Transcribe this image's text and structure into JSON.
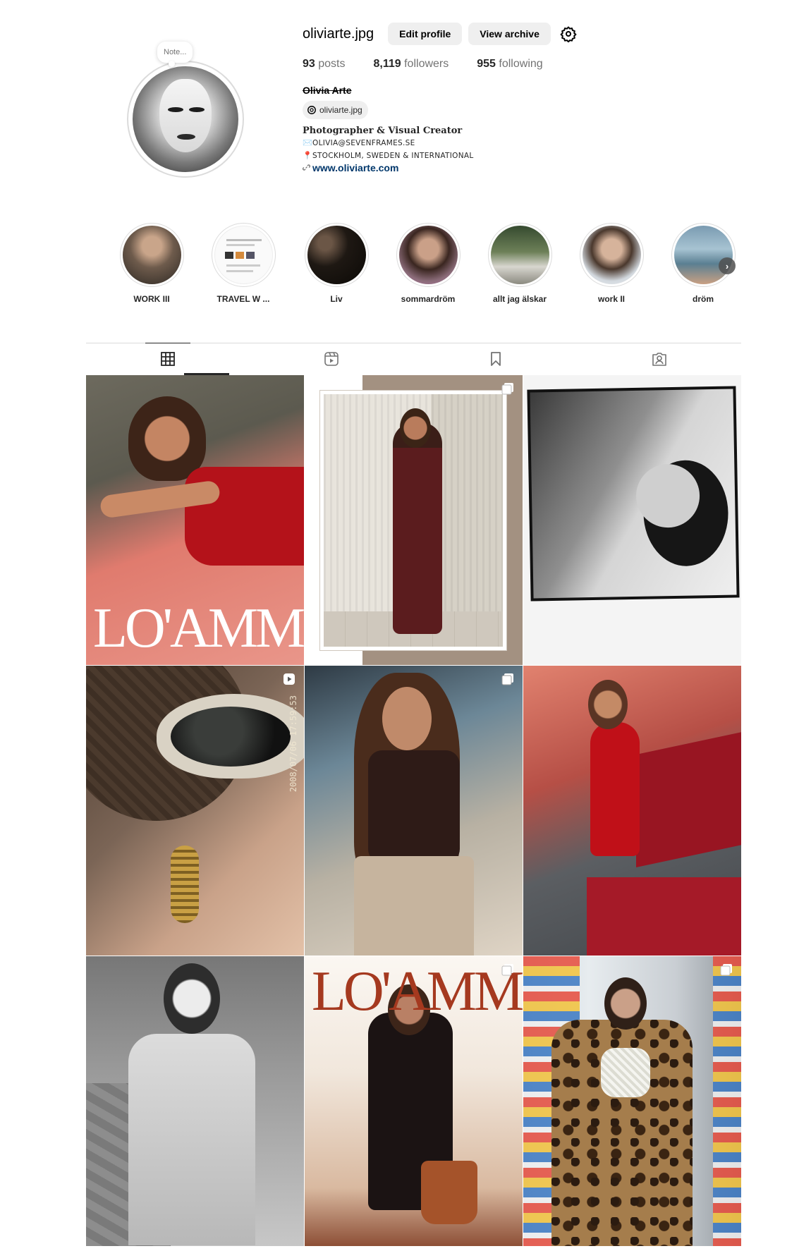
{
  "profile": {
    "username": "oliviarte.jpg",
    "edit_profile_label": "Edit profile",
    "view_archive_label": "View archive",
    "note_placeholder": "Note...",
    "stats": {
      "posts_count": "93",
      "posts_label": "posts",
      "followers_count": "8,119",
      "followers_label": "followers",
      "following_count": "955",
      "following_label": "following"
    },
    "full_name": "Olivia Arte",
    "threads_handle": "oliviarte.jpg",
    "bio": {
      "title": "Photographer & Visual Creator",
      "email_icon": "✉️",
      "email": "OLIVIA@SEVENFRAMES.SE",
      "location_icon": "📍",
      "location": "STOCKHOLM, SWEDEN & INTERNATIONAL",
      "link": "www.oliviarte.com"
    }
  },
  "highlights": [
    {
      "label": "WORK III"
    },
    {
      "label": "TRAVEL W ..."
    },
    {
      "label": "Liv"
    },
    {
      "label": "sommardröm"
    },
    {
      "label": "allt jag älskar"
    },
    {
      "label": "work II"
    },
    {
      "label": "dröm"
    }
  ],
  "tabs": [
    {
      "name": "posts",
      "icon": "grid-icon",
      "active": true
    },
    {
      "name": "reels",
      "icon": "reels-icon",
      "active": false
    },
    {
      "name": "saved",
      "icon": "bookmark-icon",
      "active": false
    },
    {
      "name": "tagged",
      "icon": "tagged-icon",
      "active": false
    }
  ],
  "posts": [
    {
      "wordmark": "LO'AMMI",
      "badge": "none"
    },
    {
      "badge": "carousel-icon"
    },
    {
      "badge": "none"
    },
    {
      "badge": "reel-icon",
      "stamp": "2008/07/06  17:59:53"
    },
    {
      "badge": "carousel-icon"
    },
    {
      "badge": "none"
    },
    {
      "badge": "none"
    },
    {
      "wordmark": "LO'AMMI",
      "badge": "carousel-icon"
    },
    {
      "badge": "carousel-icon"
    }
  ],
  "colors": {
    "text": "#262626",
    "secondary_text": "#737373",
    "button_bg": "#efefef",
    "link": "#00376b",
    "border": "#dbdbdb"
  }
}
